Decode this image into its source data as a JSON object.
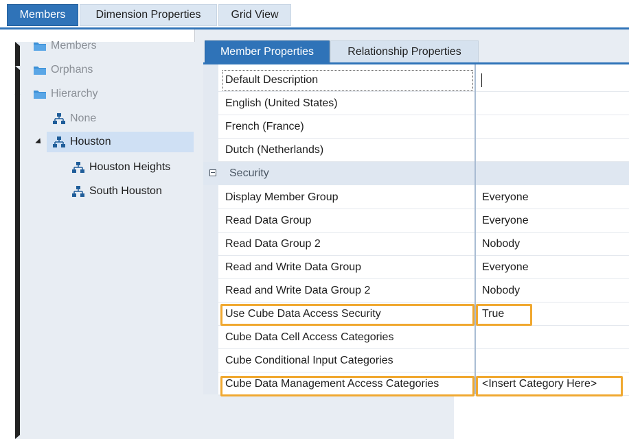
{
  "top_tabs": [
    {
      "label": "Members",
      "active": true
    },
    {
      "label": "Dimension Properties",
      "active": false
    },
    {
      "label": "Grid View",
      "active": false
    }
  ],
  "tree": {
    "items": [
      {
        "label": "Members",
        "icon": "folder-icon",
        "expander": "collapsed"
      },
      {
        "label": "Orphans",
        "icon": "folder-icon",
        "expander": "collapsed"
      },
      {
        "label": "Hierarchy",
        "icon": "folder-icon",
        "expander": "expanded"
      },
      {
        "label": "None",
        "icon": "hierarchy-icon",
        "expander": "none"
      },
      {
        "label": "Houston",
        "icon": "hierarchy-icon",
        "expander": "expanded",
        "selected": true
      },
      {
        "label": "Houston Heights",
        "icon": "hierarchy-icon",
        "expander": "none"
      },
      {
        "label": "South Houston",
        "icon": "hierarchy-icon",
        "expander": "none"
      }
    ]
  },
  "sub_tabs": [
    {
      "label": "Member Properties",
      "active": true
    },
    {
      "label": "Relationship Properties",
      "active": false
    }
  ],
  "properties": {
    "rows": [
      {
        "name": "Default Description",
        "value": ""
      },
      {
        "name": "English (United States)",
        "value": ""
      },
      {
        "name": "French (France)",
        "value": ""
      },
      {
        "name": "Dutch (Netherlands)",
        "value": ""
      }
    ],
    "category": "Security",
    "security_rows": [
      {
        "name": "Display Member Group",
        "value": "Everyone"
      },
      {
        "name": "Read Data Group",
        "value": "Everyone"
      },
      {
        "name": "Read Data Group 2",
        "value": "Nobody"
      },
      {
        "name": "Read and Write Data Group",
        "value": "Everyone"
      },
      {
        "name": "Read and Write Data Group 2",
        "value": "Nobody"
      },
      {
        "name": "Use Cube Data Access Security",
        "value": "True"
      },
      {
        "name": "Cube Data Cell Access Categories",
        "value": ""
      },
      {
        "name": "Cube Conditional Input Categories",
        "value": ""
      },
      {
        "name": "Cube Data Management Access Categories",
        "value": "<Insert Category Here>"
      }
    ]
  },
  "colors": {
    "accent": "#2f73b8",
    "highlight": "#f0a830",
    "selection": "#cfe0f4"
  }
}
